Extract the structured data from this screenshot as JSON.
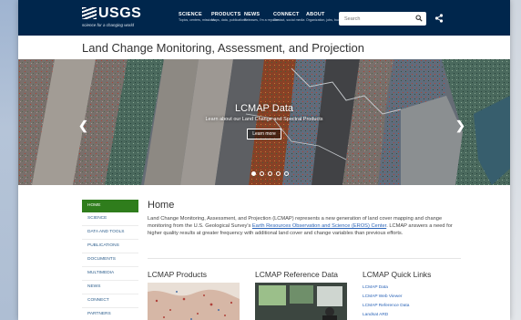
{
  "header": {
    "logo_text": "USGS",
    "logo_tagline": "science for a changing world",
    "nav": [
      {
        "title": "SCIENCE",
        "sub": "Topics, centers, missions"
      },
      {
        "title": "PRODUCTS",
        "sub": "Maps, data, publications"
      },
      {
        "title": "NEWS",
        "sub": "Releases, I'm a reporter"
      },
      {
        "title": "CONNECT",
        "sub": "Contact, social media"
      },
      {
        "title": "ABOUT",
        "sub": "Organization, jobs, budget"
      }
    ],
    "search_placeholder": "Search",
    "search_icon": "search-icon",
    "share_icon": "share-icon"
  },
  "site_title": "Land Change Monitoring, Assessment, and Projection",
  "hero": {
    "title": "LCMAP Data",
    "subtitle": "Learn about our Land Change and Spectral Products",
    "button_label": "Learn more",
    "slide_count": 5,
    "active_slide": 1
  },
  "sidebar": {
    "items": [
      {
        "label": "HOME",
        "active": true
      },
      {
        "label": "SCIENCE",
        "active": false
      },
      {
        "label": "DATA AND TOOLS",
        "active": false
      },
      {
        "label": "PUBLICATIONS",
        "active": false
      },
      {
        "label": "DOCUMENTS",
        "active": false
      },
      {
        "label": "MULTIMEDIA",
        "active": false
      },
      {
        "label": "NEWS",
        "active": false
      },
      {
        "label": "CONNECT",
        "active": false
      },
      {
        "label": "PARTNERS",
        "active": false
      }
    ]
  },
  "main": {
    "heading": "Home",
    "intro_before": "Land Change Monitoring, Assessment, and Projection (LCMAP) represents a new generation of land cover mapping and change monitoring from the U.S. Geological Survey's ",
    "intro_link": "Earth Resources Observation and Science (EROS) Center",
    "intro_after": ". LCMAP answers a need for higher quality results at greater frequency with additional land cover and change variables than previous efforts."
  },
  "columns": {
    "products_heading": "LCMAP Products",
    "reference_heading": "LCMAP Reference Data",
    "quicklinks_heading": "LCMAP Quick Links",
    "quicklinks": [
      "LCMAP Data",
      "LCMAP Web Viewer",
      "LCMAP Reference Data",
      "Landsat ARD"
    ]
  },
  "colors": {
    "header_bg": "#00264c",
    "active_nav": "#2f7d1c",
    "link": "#2a63b7"
  }
}
